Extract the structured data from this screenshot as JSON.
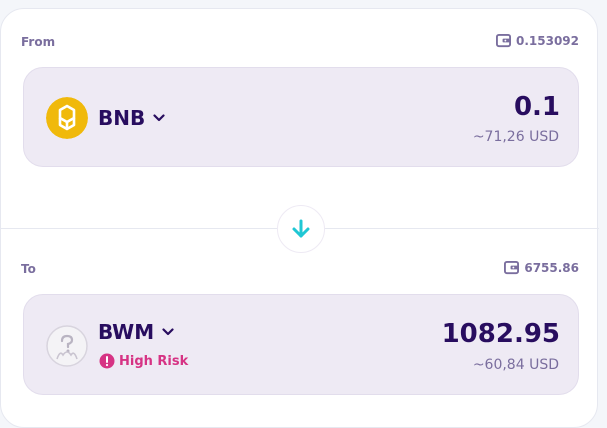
{
  "from": {
    "label": "From",
    "balance": "0.153092",
    "token": {
      "symbol": "BNB",
      "amount": "0.1",
      "usd": "~71,26 USD",
      "icon": "bnb-logo-icon"
    }
  },
  "to": {
    "label": "To",
    "balance": "6755.86",
    "token": {
      "symbol": "BWM",
      "amount": "1082.95",
      "usd": "~60,84 USD",
      "icon": "unknown-token-icon",
      "risk": "High Risk"
    }
  },
  "swap": {
    "icon": "arrow-down-icon"
  },
  "colors": {
    "text_primary": "#280d5f",
    "text_secondary": "#7a6e9e",
    "accent": "#1fc7d4",
    "token_box": "#eeeaf4",
    "bnb_yellow": "#f0b90b",
    "risk_pink": "#d63384"
  }
}
